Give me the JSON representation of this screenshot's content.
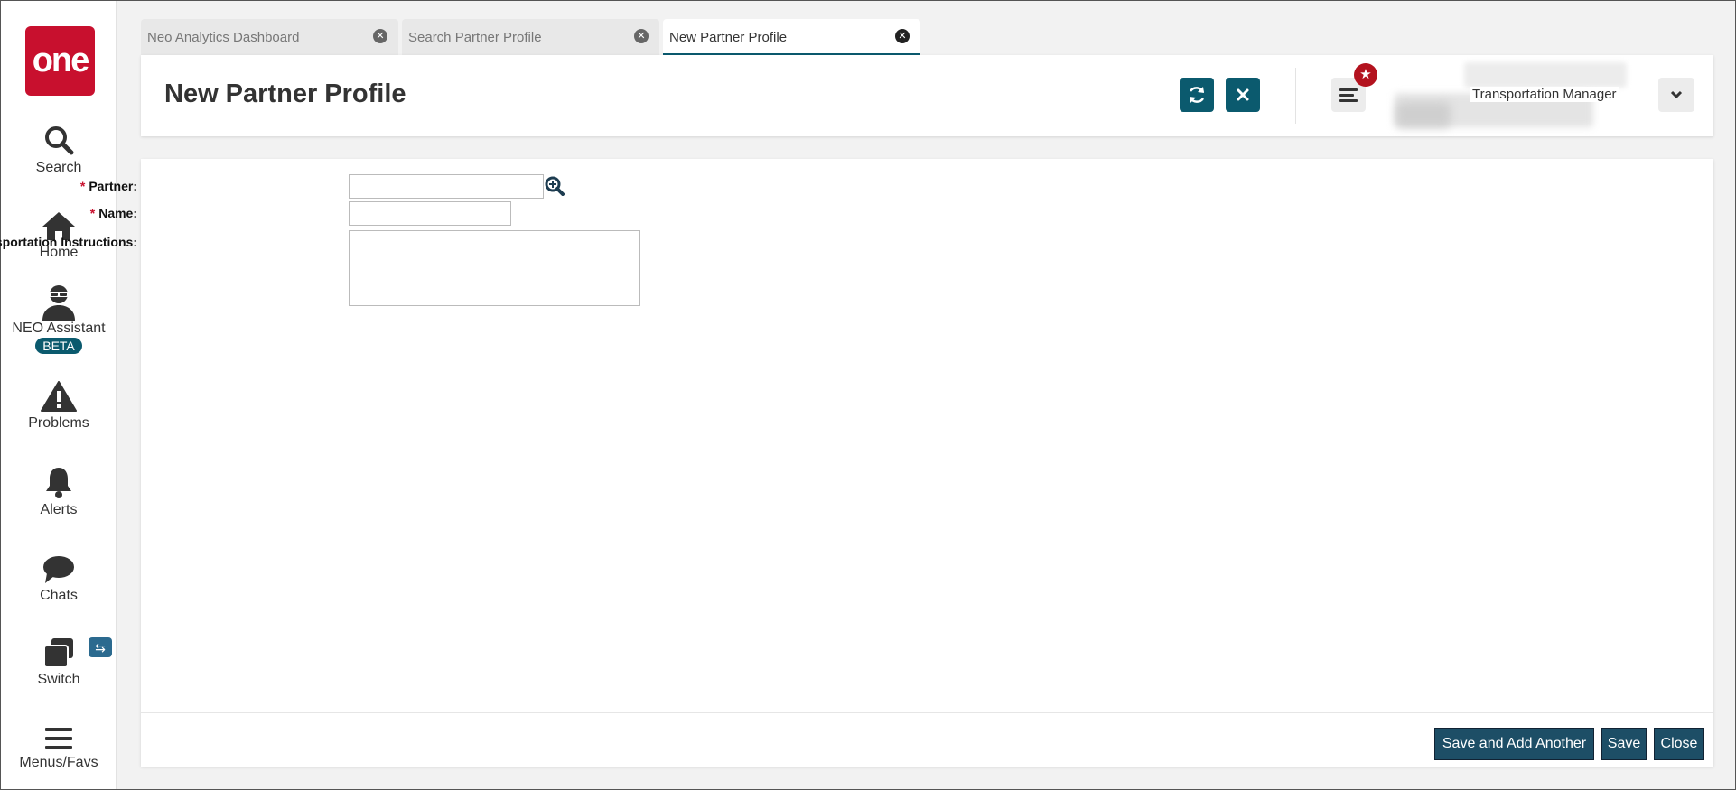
{
  "sidebar": {
    "logo_text": "one",
    "items": [
      {
        "label": "Search",
        "icon": "search-icon"
      },
      {
        "label": "Home",
        "icon": "home-icon"
      },
      {
        "label": "NEO Assistant",
        "icon": "assistant-icon",
        "badge": "BETA"
      },
      {
        "label": "Problems",
        "icon": "warning-icon"
      },
      {
        "label": "Alerts",
        "icon": "bell-icon"
      },
      {
        "label": "Chats",
        "icon": "chat-icon"
      },
      {
        "label": "Switch",
        "icon": "switch-icon",
        "badge_icon": "swap-icon"
      },
      {
        "label": "Menus/Favs",
        "icon": "hamburger-icon"
      }
    ]
  },
  "tabs": [
    {
      "label": "Neo Analytics Dashboard",
      "active": false
    },
    {
      "label": "Search Partner Profile",
      "active": false
    },
    {
      "label": "New Partner Profile",
      "active": true
    }
  ],
  "header": {
    "title": "New Partner Profile",
    "user_role": "Transportation Manager"
  },
  "form": {
    "partner_label": "Partner:",
    "name_label": "Name:",
    "instructions_label": "Transportation Instructions:",
    "required_marker": "*",
    "partner_value": "",
    "name_value": "",
    "instructions_value": ""
  },
  "footer": {
    "save_add_label": "Save and Add Another",
    "save_label": "Save",
    "close_label": "Close"
  },
  "colors": {
    "brand_red": "#c8102e",
    "accent_teal": "#0b5a6e",
    "button_navy": "#1d4e66"
  }
}
